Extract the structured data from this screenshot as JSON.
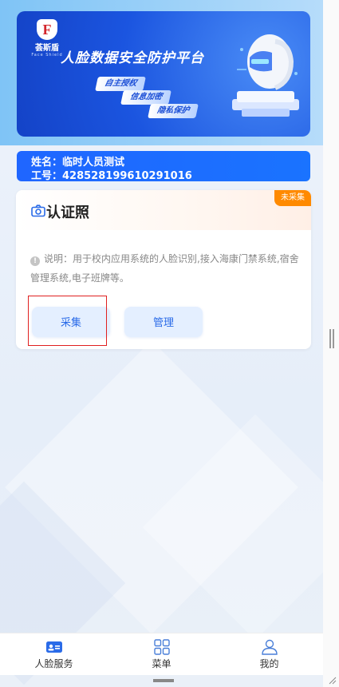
{
  "banner": {
    "logo_name": "荟斯盾",
    "logo_sub": "Face Shield",
    "title": "人脸数据安全防护平台",
    "tags": [
      "自主授权",
      "信息加密",
      "隐私保护"
    ]
  },
  "user": {
    "name_line": "姓名：临时人员测试",
    "id_line": "工号：428528199610291016"
  },
  "card": {
    "title": "认证照",
    "status": "未采集",
    "description": "说明：用于校内应用系统的人脸识别,接入海康门禁系统,宿舍管理系统,电子班牌等。",
    "buttons": {
      "collect": "采集",
      "manage": "管理"
    }
  },
  "tabbar": {
    "items": [
      {
        "label": "人脸服务",
        "icon": "id-card-icon",
        "active": true
      },
      {
        "label": "菜单",
        "icon": "grid-icon",
        "active": false
      },
      {
        "label": "我的",
        "icon": "user-icon",
        "active": false
      }
    ]
  },
  "colors": {
    "accent": "#1f66ff",
    "status_badge": "#ff8a00",
    "button_bg": "#e4efff",
    "button_text": "#2a6be8",
    "highlight_box": "#e02020"
  }
}
